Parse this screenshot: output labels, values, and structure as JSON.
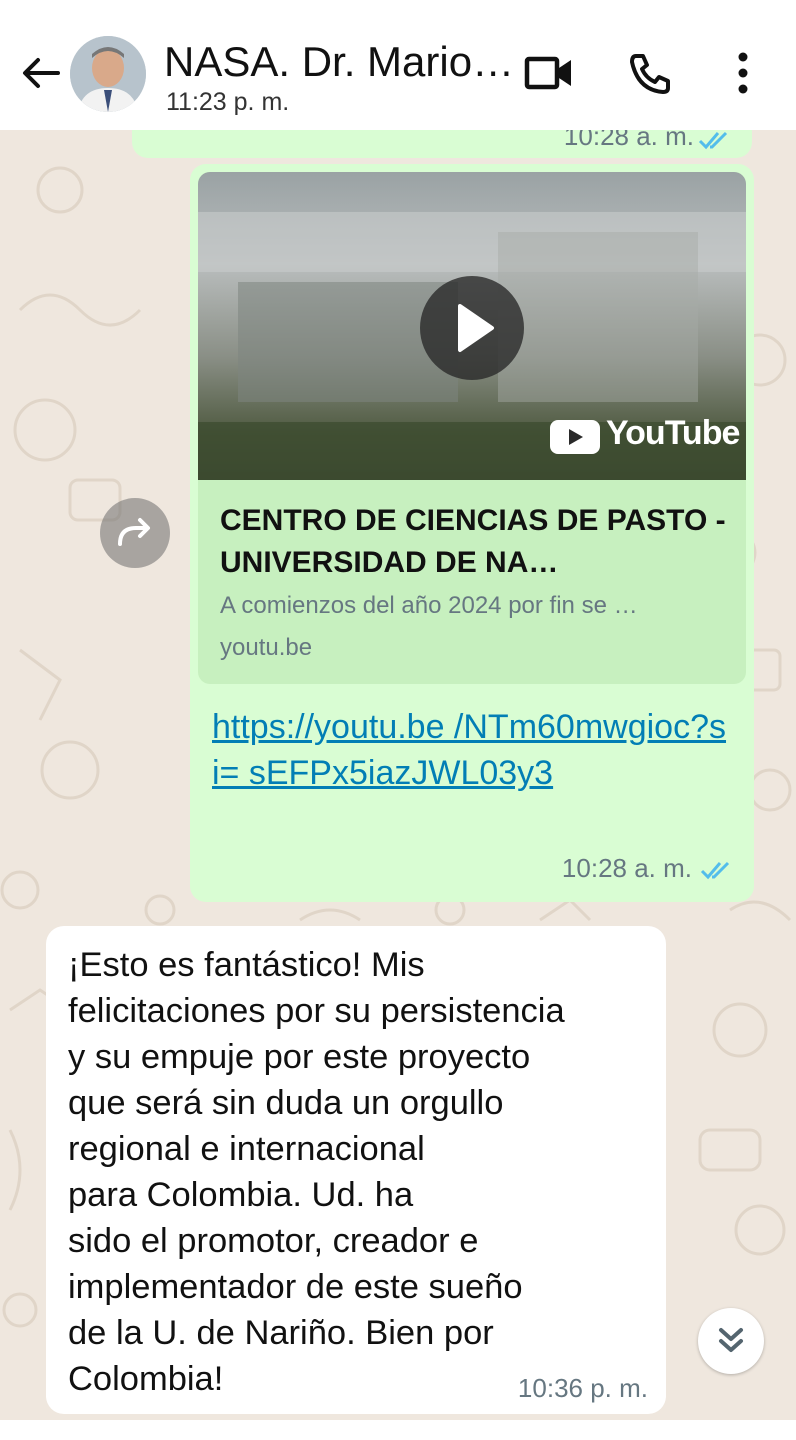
{
  "header": {
    "contact_name": "NASA. Dr. Mario…",
    "last_seen": "11:23 p. m.",
    "icons": [
      "back-arrow-icon",
      "avatar",
      "video-call-icon",
      "phone-icon",
      "more-vertical-icon"
    ]
  },
  "messages": {
    "previous_time": "10:28 a. m.",
    "link_message": {
      "preview_source": "YouTube",
      "preview_title": "CENTRO DE CIENCIAS DE PASTO -UNIVERSIDAD DE NA…",
      "preview_description": "A comienzos del año 2024 por fin se …",
      "preview_domain": "youtu.be",
      "url": "https://youtu.be /NTm60mwgioc?si= sEFPx5iazJWL03y3",
      "time": "10:28 a. m.",
      "status": "read"
    },
    "reply_message": {
      "text": "¡Esto es fantástico! Mis\nfelicitaciones por su persistencia\ny su empuje por este proyecto\nque será sin duda un orgullo\nregional e internacional\npara Colombia. Ud. ha\nsido el promotor, creador e\nimplementador de este sueño\nde la U. de Nariño. Bien por\nColombia!",
      "time": "10:36 p. m."
    }
  },
  "colors": {
    "outgoing_bubble": "#d9fdd3",
    "incoming_bubble": "#ffffff",
    "chat_background": "#efe7de",
    "link_color": "#027eb5",
    "read_ticks": "#53bdeb"
  }
}
